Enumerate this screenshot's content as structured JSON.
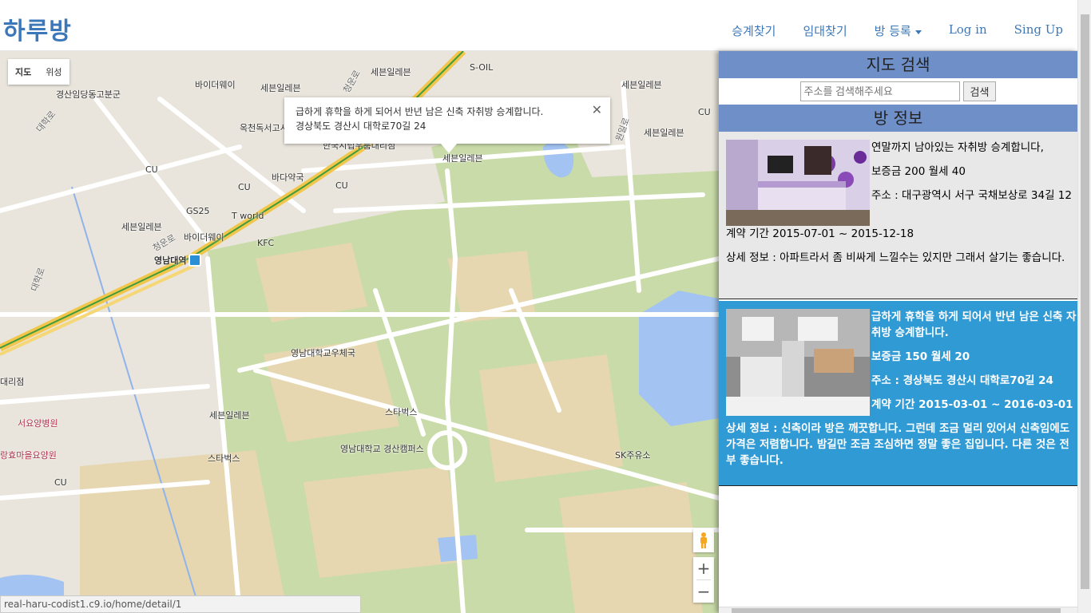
{
  "brand": "하루방",
  "nav": {
    "find_transfer": "승계찾기",
    "find_rental": "임대찾기",
    "register_room": "방 등록",
    "login": "Log in",
    "signup": "Sing Up"
  },
  "map": {
    "type_buttons": [
      "지도",
      "위성"
    ],
    "active_type": "지도",
    "labels": {
      "police": "경산임당동고분군",
      "bydw1": "바이더웨이",
      "seven1": "세븐일레븐",
      "seven2": "세븐일레븐",
      "soil": "S-OIL",
      "seven3": "세븐일레븐",
      "cu1": "CU",
      "okcheon": "옥천독서고시",
      "hanguk": "한국시립우룸대리점",
      "seven4": "세븐일레븐",
      "seven5": "세븐일레븐",
      "cu2": "CU",
      "cu3": "CU",
      "bada": "바다약국",
      "cu4": "CU",
      "gs25": "GS25",
      "seven6": "세븐일레븐",
      "tworld": "T world",
      "bydw2": "바이더웨이",
      "kfc": "KFC",
      "station": "영남대역",
      "univpost": "영남대학교우체국",
      "daerijeom": "대리점",
      "seoyo": "서요양병원",
      "seven7": "세븐일레븐",
      "starbucks1": "스타벅스",
      "campus": "영남대학교 경산캠퍼스",
      "starbucks2": "스타벅스",
      "hyoma": "랑효마을요양원",
      "cu5": "CU",
      "sk": "SK주유소",
      "road1": "청운로",
      "road2": "대학로",
      "road3": "청운로",
      "road4": "원일로",
      "road5": "대학로"
    },
    "infowindow": {
      "title": "급하게 휴학을 하게 되어서 반년 남은 신축 자취방 승계합니다.",
      "address": "경상북도 경산시 대학로70길 24"
    },
    "zoom_in": "+",
    "zoom_out": "−"
  },
  "status_url": "real-haru-codist1.c9.io/home/detail/1",
  "sidebar": {
    "search_title": "지도 검색",
    "search_placeholder": "주소를 검색해주세요",
    "search_button": "검색",
    "info_title": "방 정보",
    "listings": [
      {
        "title": "연말까지 남아있는 자취방 승계합니다,",
        "price": "보증금 200 월세 40",
        "address": "주소 : 대구광역시 서구 국채보상로 34길 12",
        "period": "계약 기간 2015-07-01 ~ 2015-12-18",
        "detail": "상세 정보 : 아파트라서 좀 비싸게 느낄수는 있지만 그래서 살기는 좋습니다."
      },
      {
        "title": "급하게 휴학을 하게 되어서 반년 남은 신축 자취방 승계합니다.",
        "price": "보증금 150 월세 20",
        "address": "주소 : 경상북도 경산시 대학로70길 24",
        "period": "계약 기간 2015-03-01 ~ 2016-03-01",
        "detail": "상세 정보 : 신축이라 방은 깨끗합니다. 그런데 조금 멀리 있어서 신축임에도 가격은 저렴합니다. 밤길만 조금 조심하면 정말 좋은 집입니다. 다른 것은 전부 좋습니다."
      }
    ]
  },
  "colors": {
    "brand": "#3c78b9",
    "section_header": "#6e8fc7",
    "selected_listing": "#2f9ad4"
  }
}
